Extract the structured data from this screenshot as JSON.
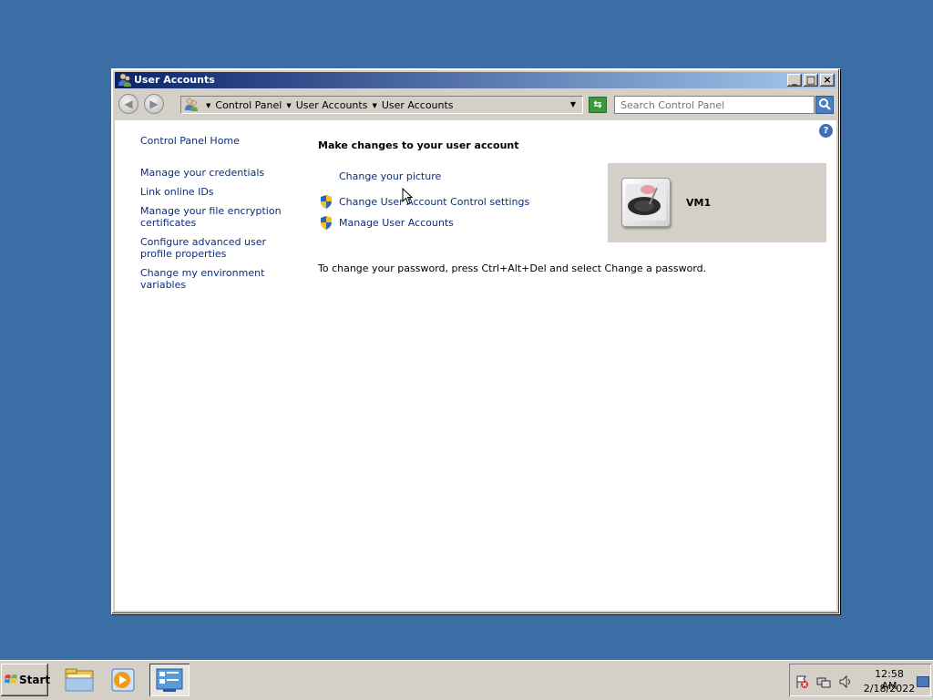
{
  "window": {
    "title": "User Accounts",
    "controls": {
      "minimize": "_",
      "maximize": "□",
      "close": "×"
    }
  },
  "navbar": {
    "breadcrumbs": [
      "Control Panel",
      "User Accounts",
      "User Accounts"
    ],
    "search_placeholder": "Search Control Panel"
  },
  "sidebar": {
    "home_link": "Control Panel Home",
    "links": [
      "Manage your credentials",
      "Link online IDs",
      "Manage your file encryption certificates",
      "Configure advanced user profile properties",
      "Change my environment variables"
    ]
  },
  "main": {
    "title": "Make changes to your user account",
    "tasks": [
      {
        "label": "Change your picture",
        "icon": "none"
      },
      {
        "label": "Change User Account Control settings",
        "icon": "shield-icon"
      },
      {
        "label": "Manage User Accounts",
        "icon": "shield-icon"
      }
    ],
    "password_note": "To change your password, press Ctrl+Alt+Del and select Change a password."
  },
  "user_tile": {
    "name": "VM1",
    "picture": "turntable-icon"
  },
  "taskbar": {
    "start_label": "Start",
    "apps": [
      "folder-icon",
      "media-player-icon",
      "control-panel-icon"
    ],
    "tray_icons": [
      "action-center-flag-icon",
      "network-icon",
      "speaker-icon"
    ],
    "clock": {
      "time": "12:58 AM",
      "date": "2/18/2022"
    }
  },
  "colors": {
    "desktop": "#3b6ea5",
    "title_gradient_start": "#0a246a",
    "title_gradient_end": "#a6caf0",
    "link": "#0b2e7a",
    "chrome": "#d4d0c8"
  }
}
